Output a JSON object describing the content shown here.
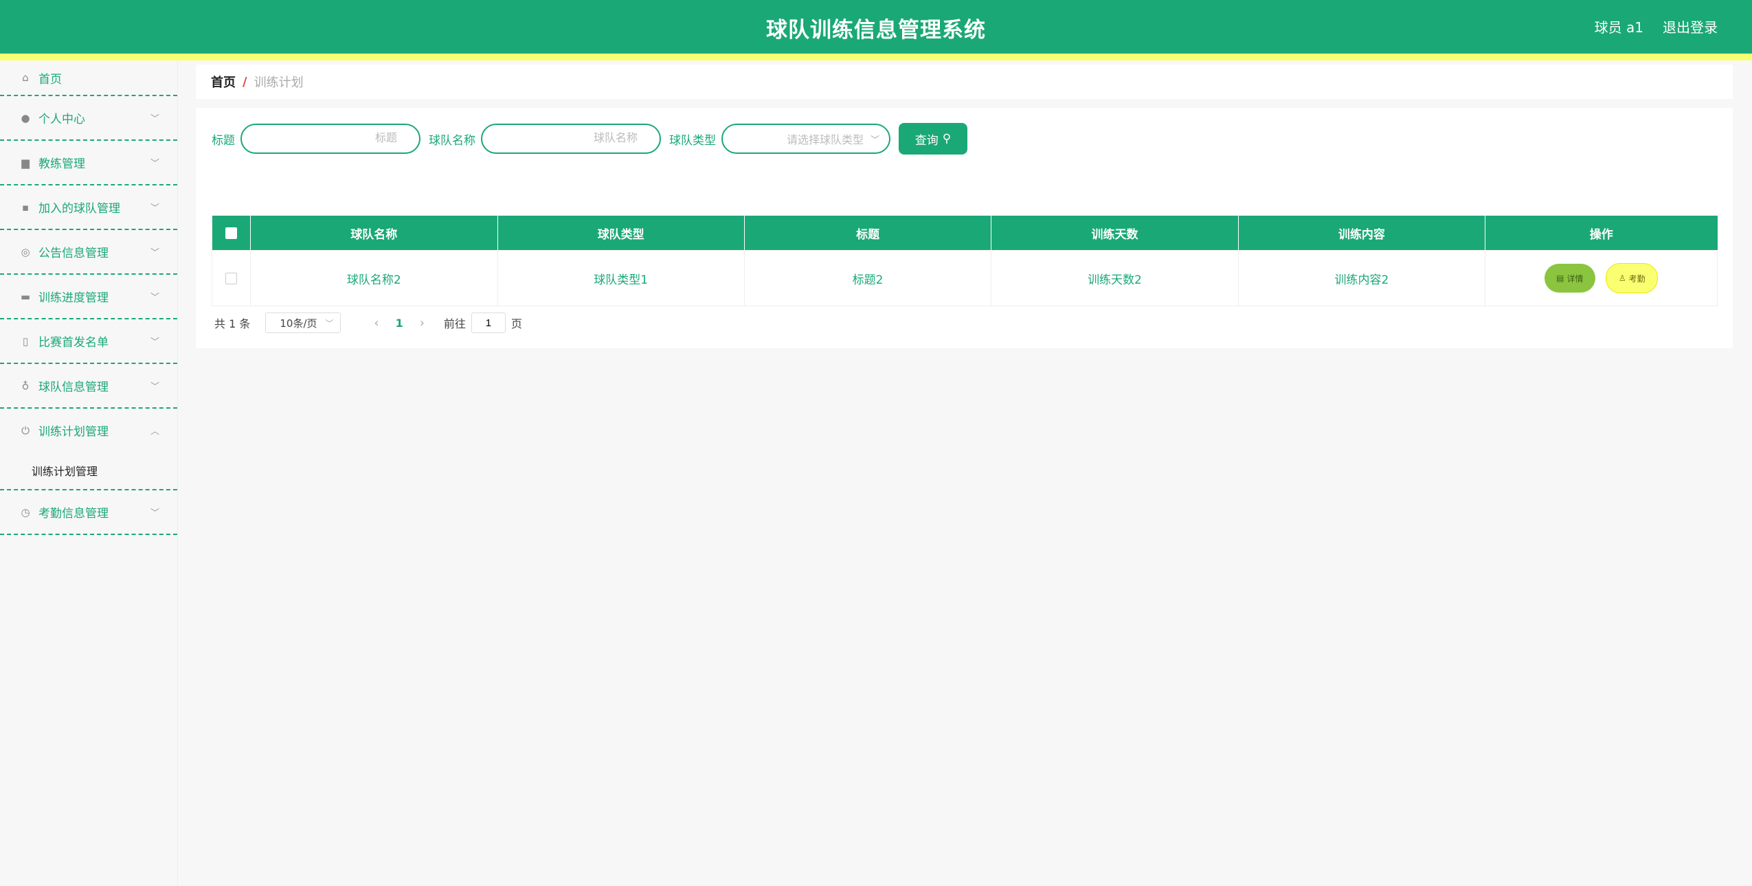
{
  "header": {
    "title": "球队训练信息管理系统",
    "user": "球员 a1",
    "logout": "退出登录"
  },
  "sidebar": {
    "items": [
      {
        "label": "首页",
        "icon": "home-icon"
      },
      {
        "label": "个人中心",
        "icon": "user-icon"
      },
      {
        "label": "教练管理",
        "icon": "bar-chart-icon"
      },
      {
        "label": "加入的球队管理",
        "icon": "chat-icon"
      },
      {
        "label": "公告信息管理",
        "icon": "target-icon"
      },
      {
        "label": "训练进度管理",
        "icon": "monitor-icon"
      },
      {
        "label": "比赛首发名单",
        "icon": "badge-icon"
      },
      {
        "label": "球队信息管理",
        "icon": "microphone-icon"
      },
      {
        "label": "训练计划管理",
        "icon": "power-icon",
        "expanded": true,
        "sub": [
          "训练计划管理"
        ]
      },
      {
        "label": "考勤信息管理",
        "icon": "clock-icon"
      }
    ]
  },
  "breadcrumb": {
    "home": "首页",
    "separator": "/",
    "current": "训练计划"
  },
  "search": {
    "title_label": "标题",
    "title_placeholder": "标题",
    "team_label": "球队名称",
    "team_placeholder": "球队名称",
    "type_label": "球队类型",
    "type_placeholder": "请选择球队类型",
    "query_button": "查询"
  },
  "table": {
    "headers": [
      "球队名称",
      "球队类型",
      "标题",
      "训练天数",
      "训练内容",
      "操作"
    ],
    "rows": [
      {
        "team": "球队名称2",
        "type": "球队类型1",
        "title": "标题2",
        "days": "训练天数2",
        "content": "训练内容2",
        "detail": "详情",
        "attendance": "考勤"
      }
    ]
  },
  "pager": {
    "total": "共 1 条",
    "page_size": "10条/页",
    "current_page": "1",
    "goto_label": "前往",
    "goto_value": "1",
    "page_suffix": "页"
  },
  "colors": {
    "primary": "#1aa877",
    "stripe": "#f5ff71",
    "detail_btn": "#8bc53f",
    "attendance_btn": "#faff72"
  }
}
